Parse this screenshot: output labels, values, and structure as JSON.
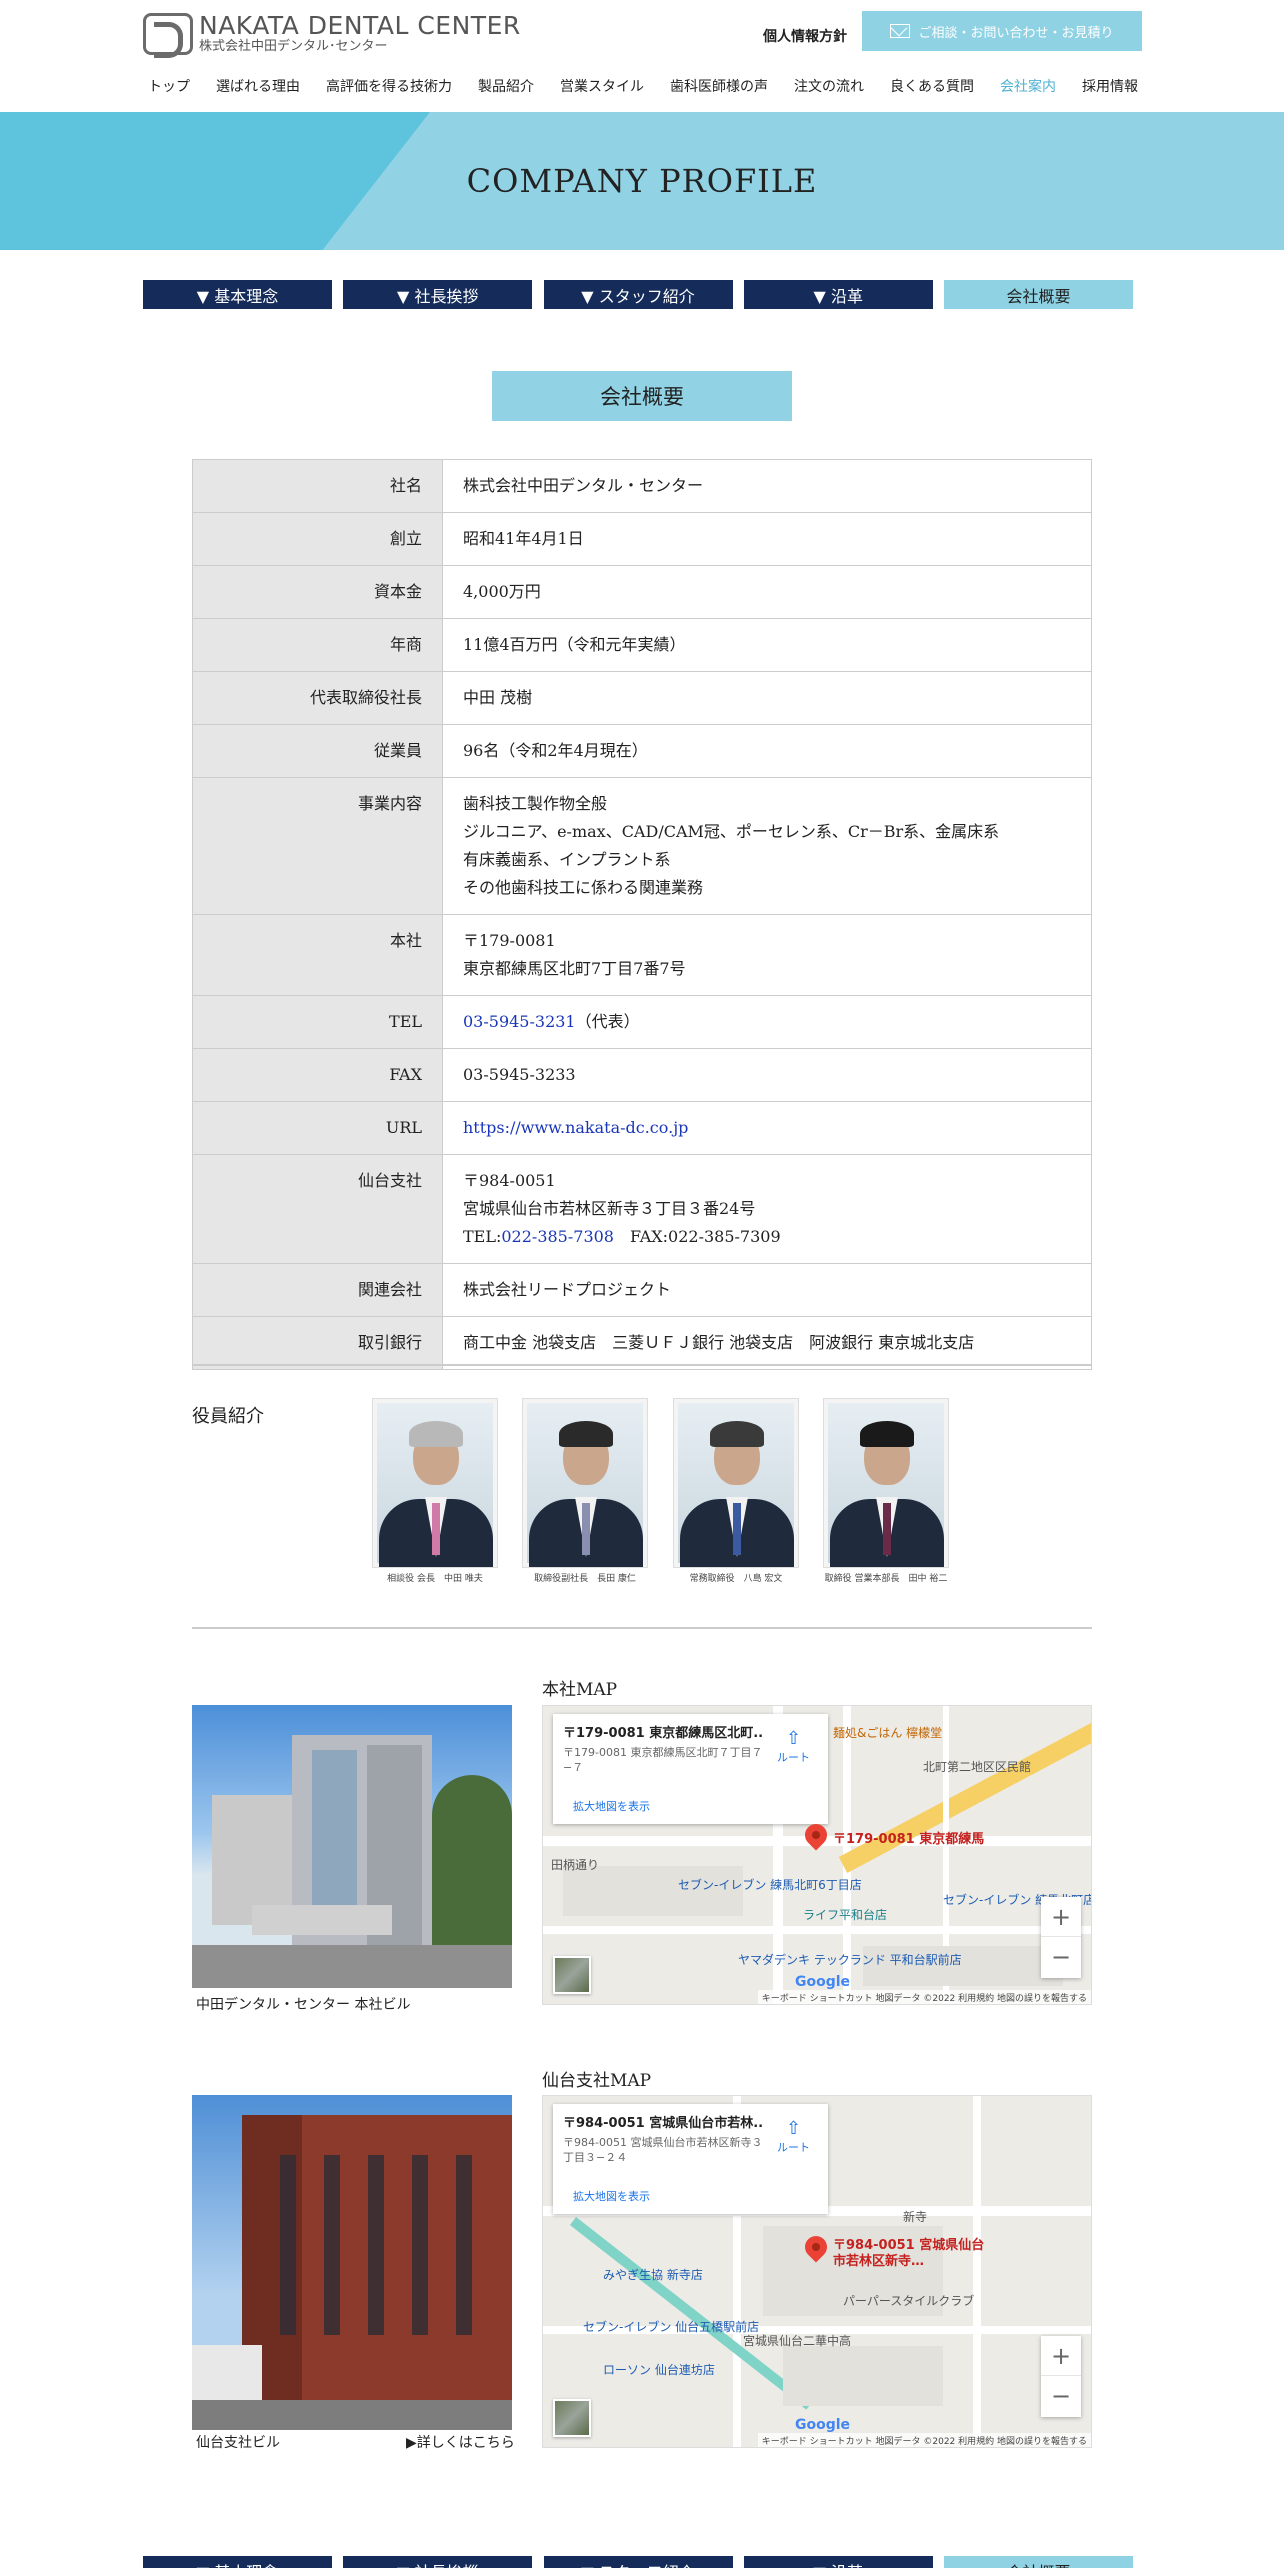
{
  "header": {
    "logo_main": "NAKATA DENTAL CENTER",
    "logo_sub": "株式会社中田デンタル･センター",
    "privacy": "個人情報方針",
    "contact": "ご相談・お問い合わせ・お見積り"
  },
  "nav": [
    "トップ",
    "選ばれる理由",
    "高評価を得る技術力",
    "製品紹介",
    "営業スタイル",
    "歯科医師様の声",
    "注文の流れ",
    "良くある質問",
    "会社案内",
    "採用情報"
  ],
  "hero_title": "COMPANY PROFILE",
  "subnav": [
    "▼ 基本理念",
    "▼ 社長挨拶",
    "▼ スタッフ紹介",
    "▼ 沿革",
    "会社概要"
  ],
  "section_title": "会社概要",
  "table": [
    {
      "label": "社名",
      "lines": [
        "株式会社中田デンタル・センター"
      ]
    },
    {
      "label": "創立",
      "lines": [
        "昭和41年4月1日"
      ]
    },
    {
      "label": "資本金",
      "lines": [
        "4,000万円"
      ]
    },
    {
      "label": "年商",
      "lines": [
        "11億4百万円（令和元年実績）"
      ]
    },
    {
      "label": "代表取締役社長",
      "lines": [
        "中田 茂樹"
      ]
    },
    {
      "label": "従業員",
      "lines": [
        "96名（令和2年4月現在）"
      ]
    },
    {
      "label": "事業内容",
      "lines": [
        "歯科技工製作物全般",
        "ジルコニア、e-max、CAD/CAM冠、ポーセレン系、Cr－Br系、金属床系",
        "有床義歯系、インプラント系",
        "その他歯科技工に係わる関連業務"
      ]
    },
    {
      "label": "本社",
      "lines": [
        "〒179-0081",
        "東京都練馬区北町7丁目7番7号"
      ]
    },
    {
      "label": "TEL",
      "tel": "03-5945-3231",
      "suffix": "（代表）"
    },
    {
      "label": "FAX",
      "lines": [
        "03-5945-3233"
      ]
    },
    {
      "label": "URL",
      "url": "https://www.nakata-dc.co.jp"
    },
    {
      "label": "仙台支社",
      "zip": "〒984-0051",
      "addr": "宮城県仙台市若林区新寺３丁目３番24号",
      "tel_prefix": "TEL:",
      "tel": "022-385-7308",
      "fax": "　FAX:022-385-7309"
    },
    {
      "label": "関連会社",
      "lines": [
        "株式会社リードプロジェクト"
      ]
    },
    {
      "label": "取引銀行",
      "lines": [
        "商工中金 池袋支店　三菱ＵＦＪ銀行 池袋支店　阿波銀行 東京城北支店"
      ]
    }
  ],
  "officers": {
    "label": "役員紹介",
    "items": [
      {
        "caption": "相談役 会長　中田 唯夫",
        "hair": "#b8b8b8",
        "tie": "#d07aa8"
      },
      {
        "caption": "取締役副社長　長田 康仁",
        "hair": "#2a2a2a",
        "tie": "#8a8fb0"
      },
      {
        "caption": "常務取締役　八島 宏文",
        "hair": "#3a3a3a",
        "tie": "#3b5aa0"
      },
      {
        "caption": "取締役 営業本部長　田中 裕二",
        "hair": "#1a1a1a",
        "tie": "#6a2b48"
      }
    ]
  },
  "hq": {
    "map_label": "本社MAP",
    "building_caption": "中田デンタル・センター 本社ビル",
    "info_title": "〒179-0081 東京都練馬区北町...",
    "info_addr": "〒179-0081 東京都練馬区北町７丁目７−７",
    "route": "ルート",
    "enlarge": "拡大地図を表示",
    "pin_label": "〒179-0081 東京都練馬",
    "pois": [
      "セブン-イレブン 練馬北町6丁目店",
      "ライフ平和台店",
      "ヤマダデンキ テックランド 平和台駅前店",
      "北町第二地区区民館",
      "セブン-イレブン 練馬北町店",
      "田柄通り",
      "麺処&ごはん 檸檬堂"
    ],
    "attribution": "キーボード ショートカット  地図データ ©2022  利用規約  地図の誤りを報告する"
  },
  "sendai": {
    "map_label": "仙台支社MAP",
    "building_caption": "仙台支社ビル",
    "detail": "▶詳しくはこちら",
    "info_title": "〒984-0051 宮城県仙台市若林...",
    "info_addr": "〒984-0051 宮城県仙台市若林区新寺３丁目３−２４",
    "route": "ルート",
    "enlarge": "拡大地図を表示",
    "pin_label": "〒984-0051 宮城県仙台市若林区新寺…",
    "pois": [
      "みやぎ生協 新寺店",
      "セブン-イレブン 仙台五橋駅前店",
      "ローソン 仙台連坊店",
      "宮城県仙台二華中高",
      "パーパースタイルクラブ",
      "新寺"
    ],
    "attribution": "キーボード ショートカット  地図データ ©2022  利用規約  地図の誤りを報告する"
  },
  "maps_common": {
    "google": "Google",
    "zoom_in": "+",
    "zoom_out": "−"
  },
  "colors": {
    "accent": "#8fd2e3",
    "navy": "#152c5b",
    "link": "#1a36b8"
  }
}
